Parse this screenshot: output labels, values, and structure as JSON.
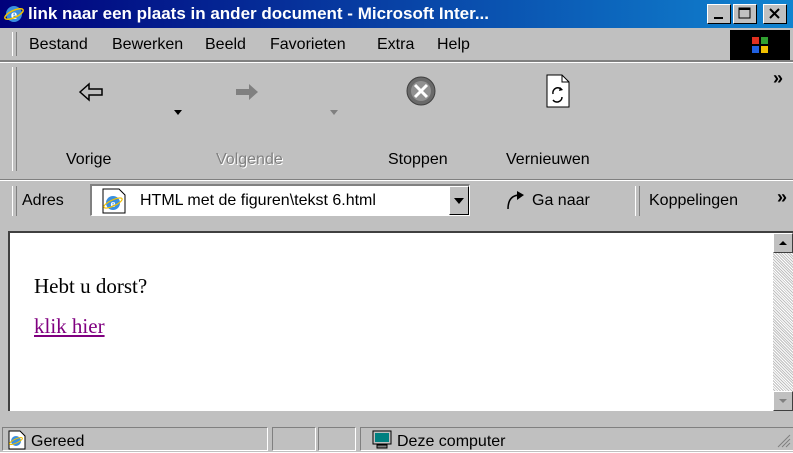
{
  "window": {
    "title": "link naar een plaats in ander document - Microsoft Inter...",
    "colors": {
      "titlebar_start": "#00007b",
      "titlebar_end": "#1084d0",
      "chrome": "#c0c0c0",
      "link": "#800080"
    }
  },
  "menu": {
    "items": [
      {
        "label": "Bestand",
        "icon": ""
      },
      {
        "label": "Bewerken"
      },
      {
        "label": "Beeld"
      },
      {
        "label": "Favorieten"
      },
      {
        "label": "Extra"
      },
      {
        "label": "Help"
      }
    ]
  },
  "toolbar": {
    "back_label": "Vorige",
    "forward_label": "Volgende",
    "stop_label": "Stoppen",
    "refresh_label": "Vernieuwen",
    "more_label": "»"
  },
  "address": {
    "label": "Adres",
    "value": "HTML met de figuren\\tekst 6.html",
    "go_label": "Ga naar",
    "links_label": "Koppelingen",
    "more_label": "»"
  },
  "document": {
    "line1": "Hebt u dorst?",
    "link_text": "klik hier"
  },
  "status": {
    "text": "Gereed",
    "zone": "Deze computer"
  }
}
